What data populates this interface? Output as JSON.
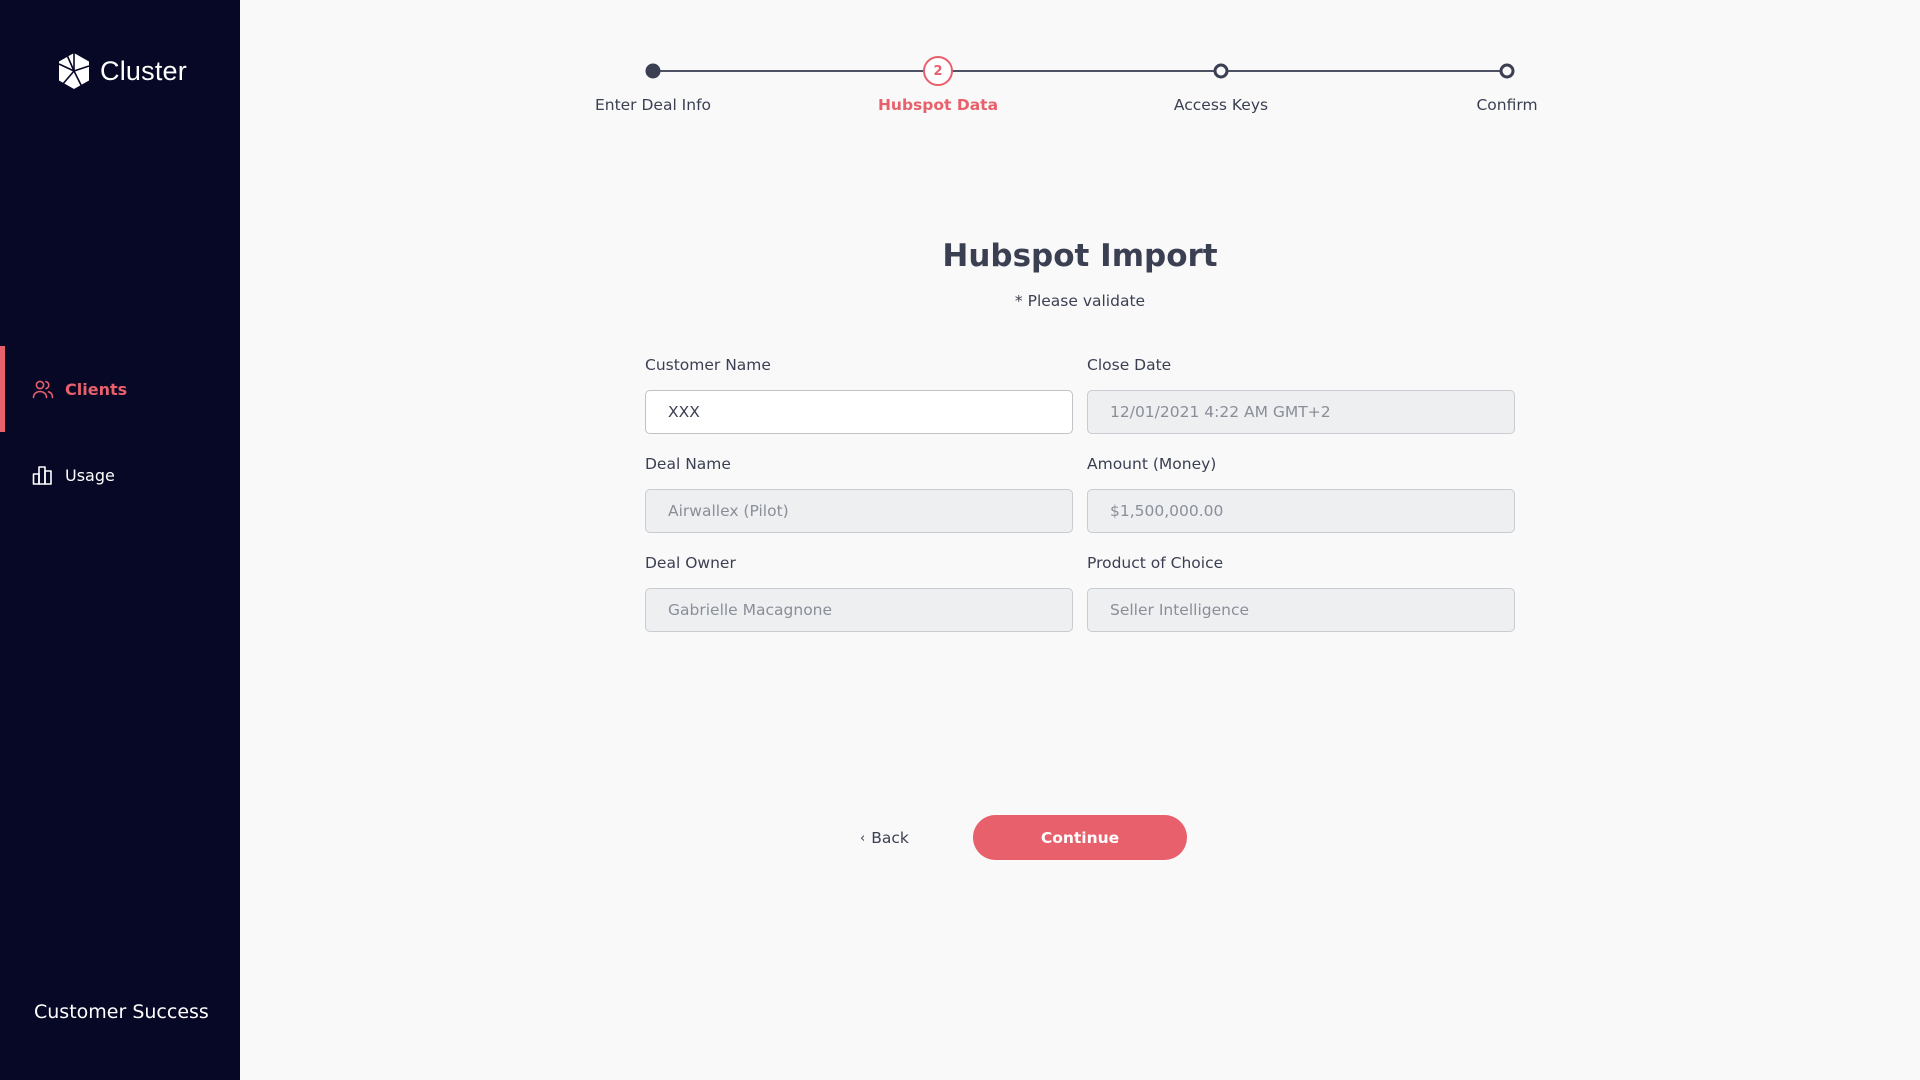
{
  "brand": {
    "name": "Cluster",
    "logo_icon": "cluster-logo-icon"
  },
  "sidebar": {
    "items": [
      {
        "label": "Clients",
        "icon": "users-icon",
        "active": true
      },
      {
        "label": "Usage",
        "icon": "bar-chart-icon",
        "active": false
      }
    ],
    "footer": "Customer Success"
  },
  "stepper": {
    "steps": [
      {
        "label": "Enter Deal Info",
        "state": "done"
      },
      {
        "label": "Hubspot Data",
        "state": "current",
        "number": "2"
      },
      {
        "label": "Access Keys",
        "state": "upcoming"
      },
      {
        "label": "Confirm",
        "state": "upcoming"
      }
    ]
  },
  "main": {
    "title": "Hubspot Import",
    "subtitle": "* Please validate"
  },
  "form": {
    "customer_name": {
      "label": "Customer Name",
      "value": "XXX"
    },
    "close_date": {
      "label": "Close Date",
      "value": "12/01/2021 4:22 AM GMT+2"
    },
    "deal_name": {
      "label": "Deal Name",
      "value": "Airwallex (Pilot)"
    },
    "amount": {
      "label": "Amount (Money)",
      "value": "$1,500,000.00"
    },
    "deal_owner": {
      "label": "Deal Owner",
      "value": "Gabrielle Macagnone"
    },
    "product": {
      "label": "Product of Choice",
      "value": "Seller Intelligence"
    }
  },
  "actions": {
    "back_label": "Back",
    "continue_label": "Continue"
  },
  "colors": {
    "sidebar_bg": "#070726",
    "accent": "#e8606b",
    "text": "#3b3f52",
    "page_bg": "#f9f9f9"
  }
}
